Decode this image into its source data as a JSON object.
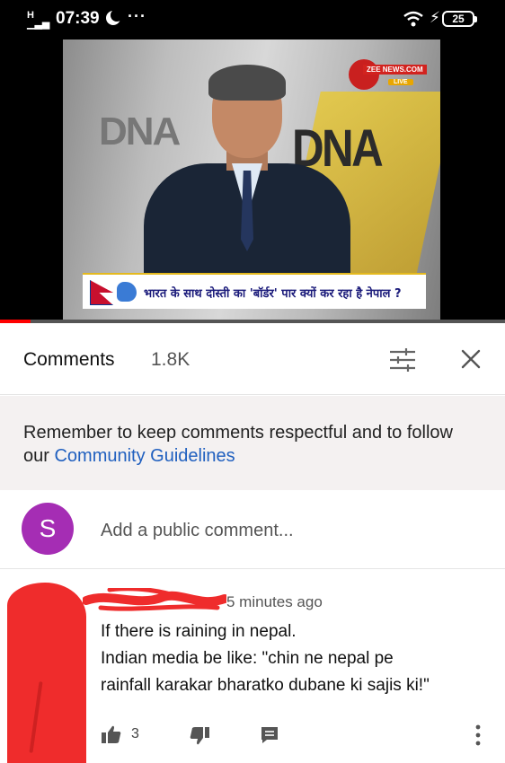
{
  "status_bar": {
    "signal": "H",
    "time": "07:39",
    "dots": "···",
    "battery": "25",
    "icons": [
      "signal-icon",
      "moon-icon",
      "wifi-icon",
      "charging-icon",
      "battery-icon"
    ]
  },
  "video": {
    "watermark_left": "DNA",
    "watermark_right": "DNA",
    "channel_logo": "ZEE NEWS.COM",
    "live_badge": "LIVE",
    "ticker": "भारत के साथ दोस्ती का 'बॉर्डर' पार क्यों कर रहा है नेपाल ?",
    "progress_fraction": 0.06
  },
  "comments_header": {
    "title": "Comments",
    "count": "1.8K",
    "sort_icon": "sort-icon",
    "close_icon": "close-icon"
  },
  "guidelines": {
    "text": "Remember to keep comments respectful and to follow our ",
    "link": "Community Guidelines"
  },
  "add_comment": {
    "avatar_letter": "S",
    "avatar_color": "#a52db4",
    "placeholder": "Add a public comment..."
  },
  "comment": {
    "time": "5 minutes ago",
    "lines": [
      "If there is raining in nepal.",
      "Indian media be like: \"chin ne nepal pe",
      "rainfall karakar bharatko dubane ki sajis ki!\""
    ],
    "likes": "3",
    "icons": [
      "thumbs-up-icon",
      "thumbs-down-icon",
      "reply-icon",
      "more-vert-icon"
    ]
  },
  "colors": {
    "accent_link": "#1f5fbf",
    "redaction": "#ef2c2c",
    "progress": "#ff0000"
  }
}
